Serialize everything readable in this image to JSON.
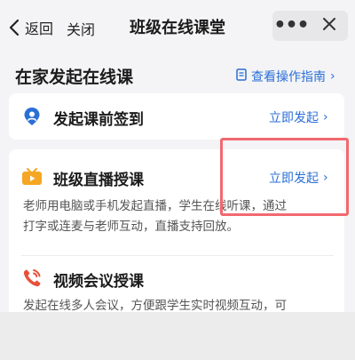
{
  "nav": {
    "back_label": "返回",
    "close_label": "关闭",
    "title": "班级在线课堂",
    "more_symbol": "•••"
  },
  "section": {
    "title": "在家发起在线课",
    "guide_link": "查看操作指南",
    "guide_arrow": "›"
  },
  "items": [
    {
      "title": "发起课前签到",
      "action": "立即发起",
      "arrow": "›",
      "icon": "location-pin-icon",
      "icon_color": "#2b6fd6"
    },
    {
      "title": "班级直播授课",
      "action": "立即发起",
      "arrow": "›",
      "icon": "live-tv-icon",
      "icon_color": "#f5a623",
      "description_line1": "老师用电脑或手机发起直播，学生在线听课，通过",
      "description_line2": "打字或连麦与老师互动，直播支持回放。"
    },
    {
      "title": "视频会议授课",
      "icon": "phone-call-icon",
      "icon_color": "#e8503a",
      "description_line1": "发起在线多人会议，方便跟学生实时视频互动，可"
    }
  ],
  "colors": {
    "link": "#2b6fd6",
    "highlight": "#f2686f",
    "background": "#f4f4f6"
  }
}
